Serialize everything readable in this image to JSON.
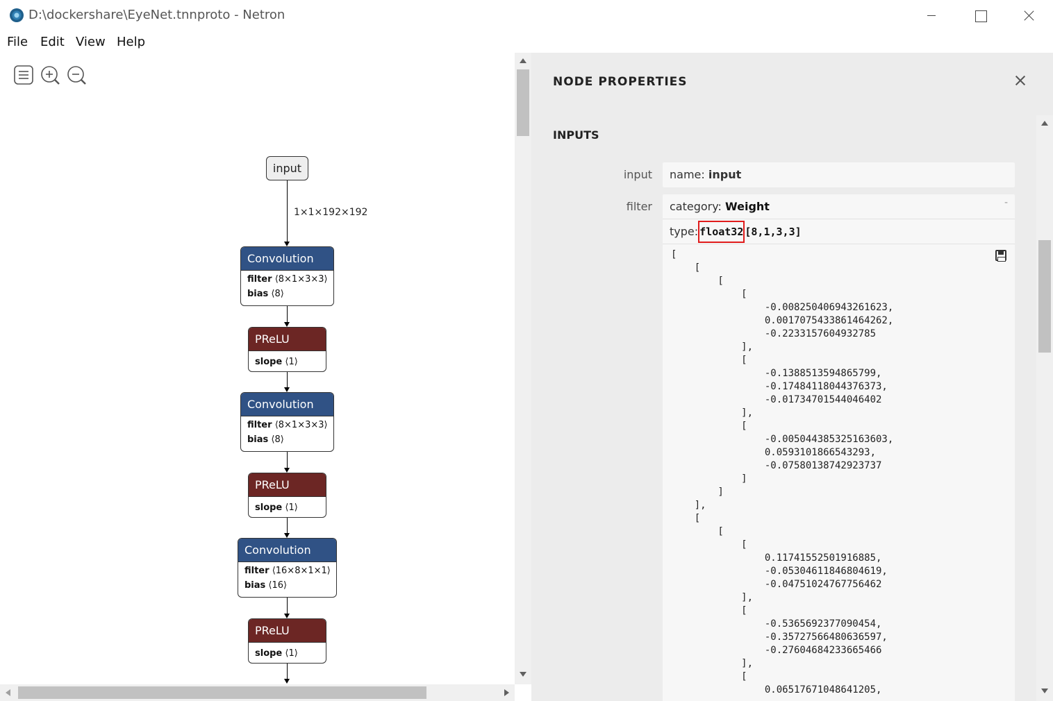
{
  "window": {
    "title": "D:\\dockershare\\EyeNet.tnnproto - Netron",
    "icon": "netron-app-icon"
  },
  "menu": [
    "File",
    "Edit",
    "View",
    "Help"
  ],
  "toolbar": {
    "icons": [
      "sidebar-menu-icon",
      "zoom-in-icon",
      "zoom-out-icon"
    ]
  },
  "graph": {
    "input_node": "input",
    "input_edge_label": "1×1×192×192",
    "nodes": [
      {
        "type": "Convolution",
        "kind": "conv",
        "attrs": [
          {
            "name": "filter",
            "value": "⟨8×1×3×3⟩"
          },
          {
            "name": "bias",
            "value": "⟨8⟩"
          }
        ]
      },
      {
        "type": "PReLU",
        "kind": "prelu",
        "attrs": [
          {
            "name": "slope",
            "value": "⟨1⟩"
          }
        ]
      },
      {
        "type": "Convolution",
        "kind": "conv",
        "attrs": [
          {
            "name": "filter",
            "value": "⟨8×1×3×3⟩"
          },
          {
            "name": "bias",
            "value": "⟨8⟩"
          }
        ]
      },
      {
        "type": "PReLU",
        "kind": "prelu",
        "attrs": [
          {
            "name": "slope",
            "value": "⟨1⟩"
          }
        ]
      },
      {
        "type": "Convolution",
        "kind": "conv",
        "attrs": [
          {
            "name": "filter",
            "value": "⟨16×8×1×1⟩"
          },
          {
            "name": "bias",
            "value": "⟨16⟩"
          }
        ]
      },
      {
        "type": "PReLU",
        "kind": "prelu",
        "attrs": [
          {
            "name": "slope",
            "value": "⟨1⟩"
          }
        ]
      }
    ],
    "colors": {
      "conv": "#305285",
      "prelu": "#6c2624"
    }
  },
  "sidebar": {
    "title": "NODE PROPERTIES",
    "section": "INPUTS",
    "input": {
      "label": "input",
      "name_key": "name:",
      "name_value": "input"
    },
    "filter": {
      "label": "filter",
      "category_key": "category:",
      "category_value": "Weight",
      "collapse": "-",
      "type_key": "type:",
      "dtype": "float32",
      "shape": "[8,1,3,3]",
      "tensor_lines": [
        "[",
        "    [",
        "        [",
        "            [",
        "                -0.008250406943261623,",
        "                0.0017075433861464262,",
        "                -0.2233157604932785",
        "            ],",
        "            [",
        "                -0.1388513594865799,",
        "                -0.17484118044376373,",
        "                -0.01734701544046402",
        "            ],",
        "            [",
        "                -0.005044385325163603,",
        "                0.0593101866543293,",
        "                -0.07580138742923737",
        "            ]",
        "        ]",
        "    ],",
        "    [",
        "        [",
        "            [",
        "                0.11741552501916885,",
        "                -0.05304611846804619,",
        "                -0.04751024767756462",
        "            ],",
        "            [",
        "                -0.5365692377090454,",
        "                -0.35727566480636597,",
        "                -0.27604684233665466",
        "            ],",
        "            [",
        "                0.06517671048641205,"
      ]
    },
    "highlight_color": "#e01b1b"
  }
}
